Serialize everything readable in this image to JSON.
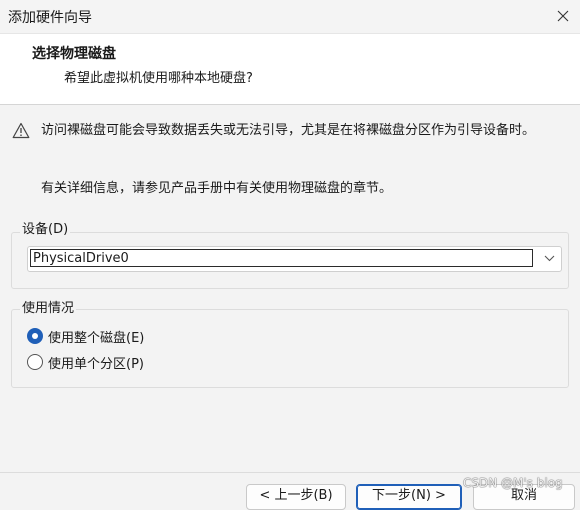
{
  "window": {
    "title": "添加硬件向导",
    "close_icon": "close-icon"
  },
  "header": {
    "title": "选择物理磁盘",
    "subtitle": "希望此虚拟机使用哪种本地硬盘?"
  },
  "warning": {
    "icon": "warning-icon",
    "text": "访问裸磁盘可能会导致数据丢失或无法引导，尤其是在将裸磁盘分区作为引导设备时。"
  },
  "info_text": "有关详细信息，请参见产品手册中有关使用物理磁盘的章节。",
  "device": {
    "group_label": "设备(D)",
    "selected": "PhysicalDrive0",
    "chevron_icon": "chevron-down-icon"
  },
  "usage": {
    "group_label": "使用情况",
    "options": [
      {
        "label": "使用整个磁盘(E)",
        "checked": true
      },
      {
        "label": "使用单个分区(P)",
        "checked": false
      }
    ]
  },
  "buttons": {
    "back": "< 上一步(B)",
    "next": "下一步(N) >",
    "cancel": "取消"
  },
  "watermark": "CSDN @M's blog",
  "colors": {
    "accent": "#1f5fb8",
    "window_bg": "#f3f3f3",
    "header_bg": "#ffffff"
  }
}
